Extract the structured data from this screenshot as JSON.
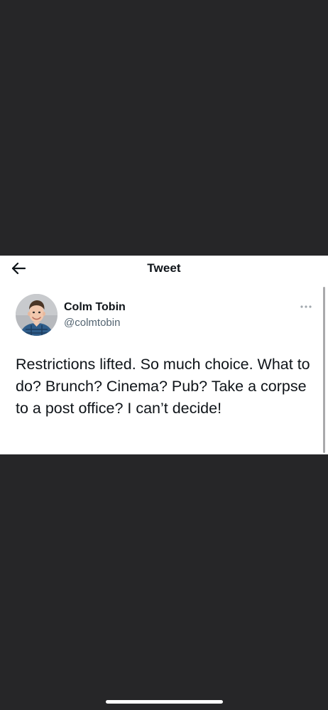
{
  "header": {
    "title": "Tweet",
    "back_icon": "arrow-left-icon"
  },
  "tweet": {
    "author_name": "Colm Tobin",
    "author_handle": "@colmtobin",
    "more_icon": "more-horizontal-icon",
    "text": "Restrictions lifted. So much choice. What to do? Brunch? Cinema? Pub? Take a corpse to a post office? I can’t decide!"
  },
  "colors": {
    "background": "#262628",
    "card": "#ffffff",
    "text_primary": "#0f1419",
    "text_secondary": "#536471"
  }
}
